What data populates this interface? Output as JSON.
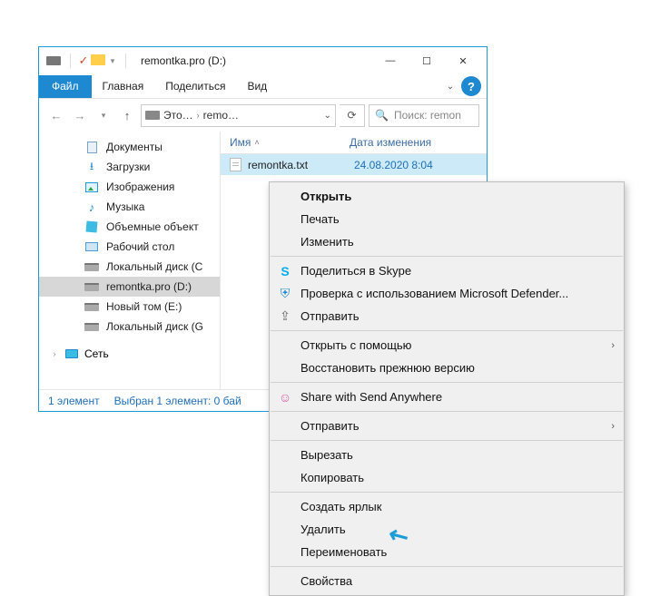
{
  "titlebar": {
    "title": "remontka.pro (D:)",
    "minimize": "—",
    "maximize": "☐",
    "close": "✕"
  },
  "ribbon": {
    "file": "Файл",
    "home": "Главная",
    "share": "Поделиться",
    "view": "Вид"
  },
  "nav": {
    "breadcrumbs": [
      "Это…",
      "remo…"
    ],
    "search_placeholder": "Поиск: remon"
  },
  "tree": {
    "documents": "Документы",
    "downloads": "Загрузки",
    "images": "Изображения",
    "music": "Музыка",
    "objects3d": "Объемные объект",
    "desktop": "Рабочий стол",
    "localdisk_c": "Локальный диск (С",
    "remontka": "remontka.pro (D:)",
    "newvol": "Новый том (E:)",
    "localdisk_g": "Локальный диск (G",
    "network": "Сеть"
  },
  "columns": {
    "name": "Имя",
    "date": "Дата изменения"
  },
  "file": {
    "name": "remontka.txt",
    "date": "24.08.2020 8:04"
  },
  "status": {
    "count": "1 элемент",
    "selection": "Выбран 1 элемент: 0 бай"
  },
  "ctx": {
    "open": "Открыть",
    "print": "Печать",
    "edit": "Изменить",
    "skype": "Поделиться в Skype",
    "defender": "Проверка с использованием Microsoft Defender...",
    "sendto_share": "Отправить",
    "openwith": "Открыть с помощью",
    "restore": "Восстановить прежнюю версию",
    "sendanywhere": "Share with Send Anywhere",
    "sendto": "Отправить",
    "cut": "Вырезать",
    "copy": "Копировать",
    "shortcut": "Создать ярлык",
    "delete": "Удалить",
    "rename": "Переименовать",
    "properties": "Свойства"
  }
}
